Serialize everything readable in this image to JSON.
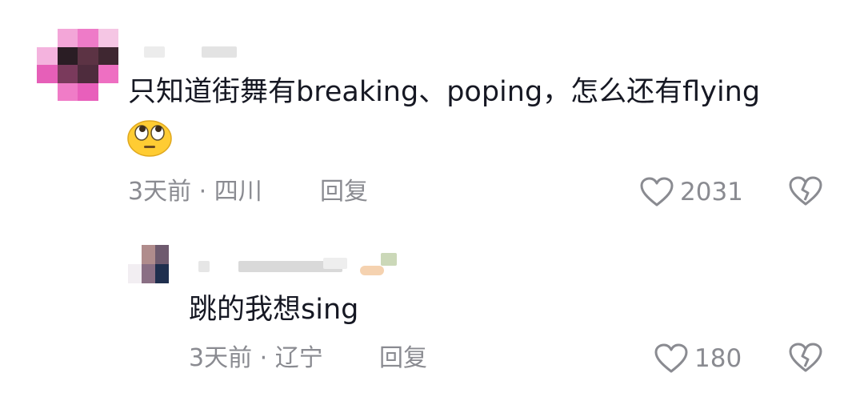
{
  "comment": {
    "text": "只知道街舞有breaking、poping，怎么还有flying",
    "emoji": "🙄",
    "time": "3天前",
    "location": "四川",
    "reply_label": "回复",
    "likes": "2031",
    "icons": {
      "like": "heart-outline-icon",
      "dislike": "broken-heart-icon",
      "emoji": "eye-roll-emoji"
    }
  },
  "reply": {
    "text": "跳的我想sing",
    "time": "3天前",
    "location": "辽宁",
    "reply_label": "回复",
    "likes": "180",
    "icons": {
      "like": "heart-outline-icon",
      "dislike": "broken-heart-icon"
    }
  },
  "colors": {
    "text": "#161823",
    "meta": "#8a8b91",
    "avatar_accent": "#ee5fbd"
  }
}
